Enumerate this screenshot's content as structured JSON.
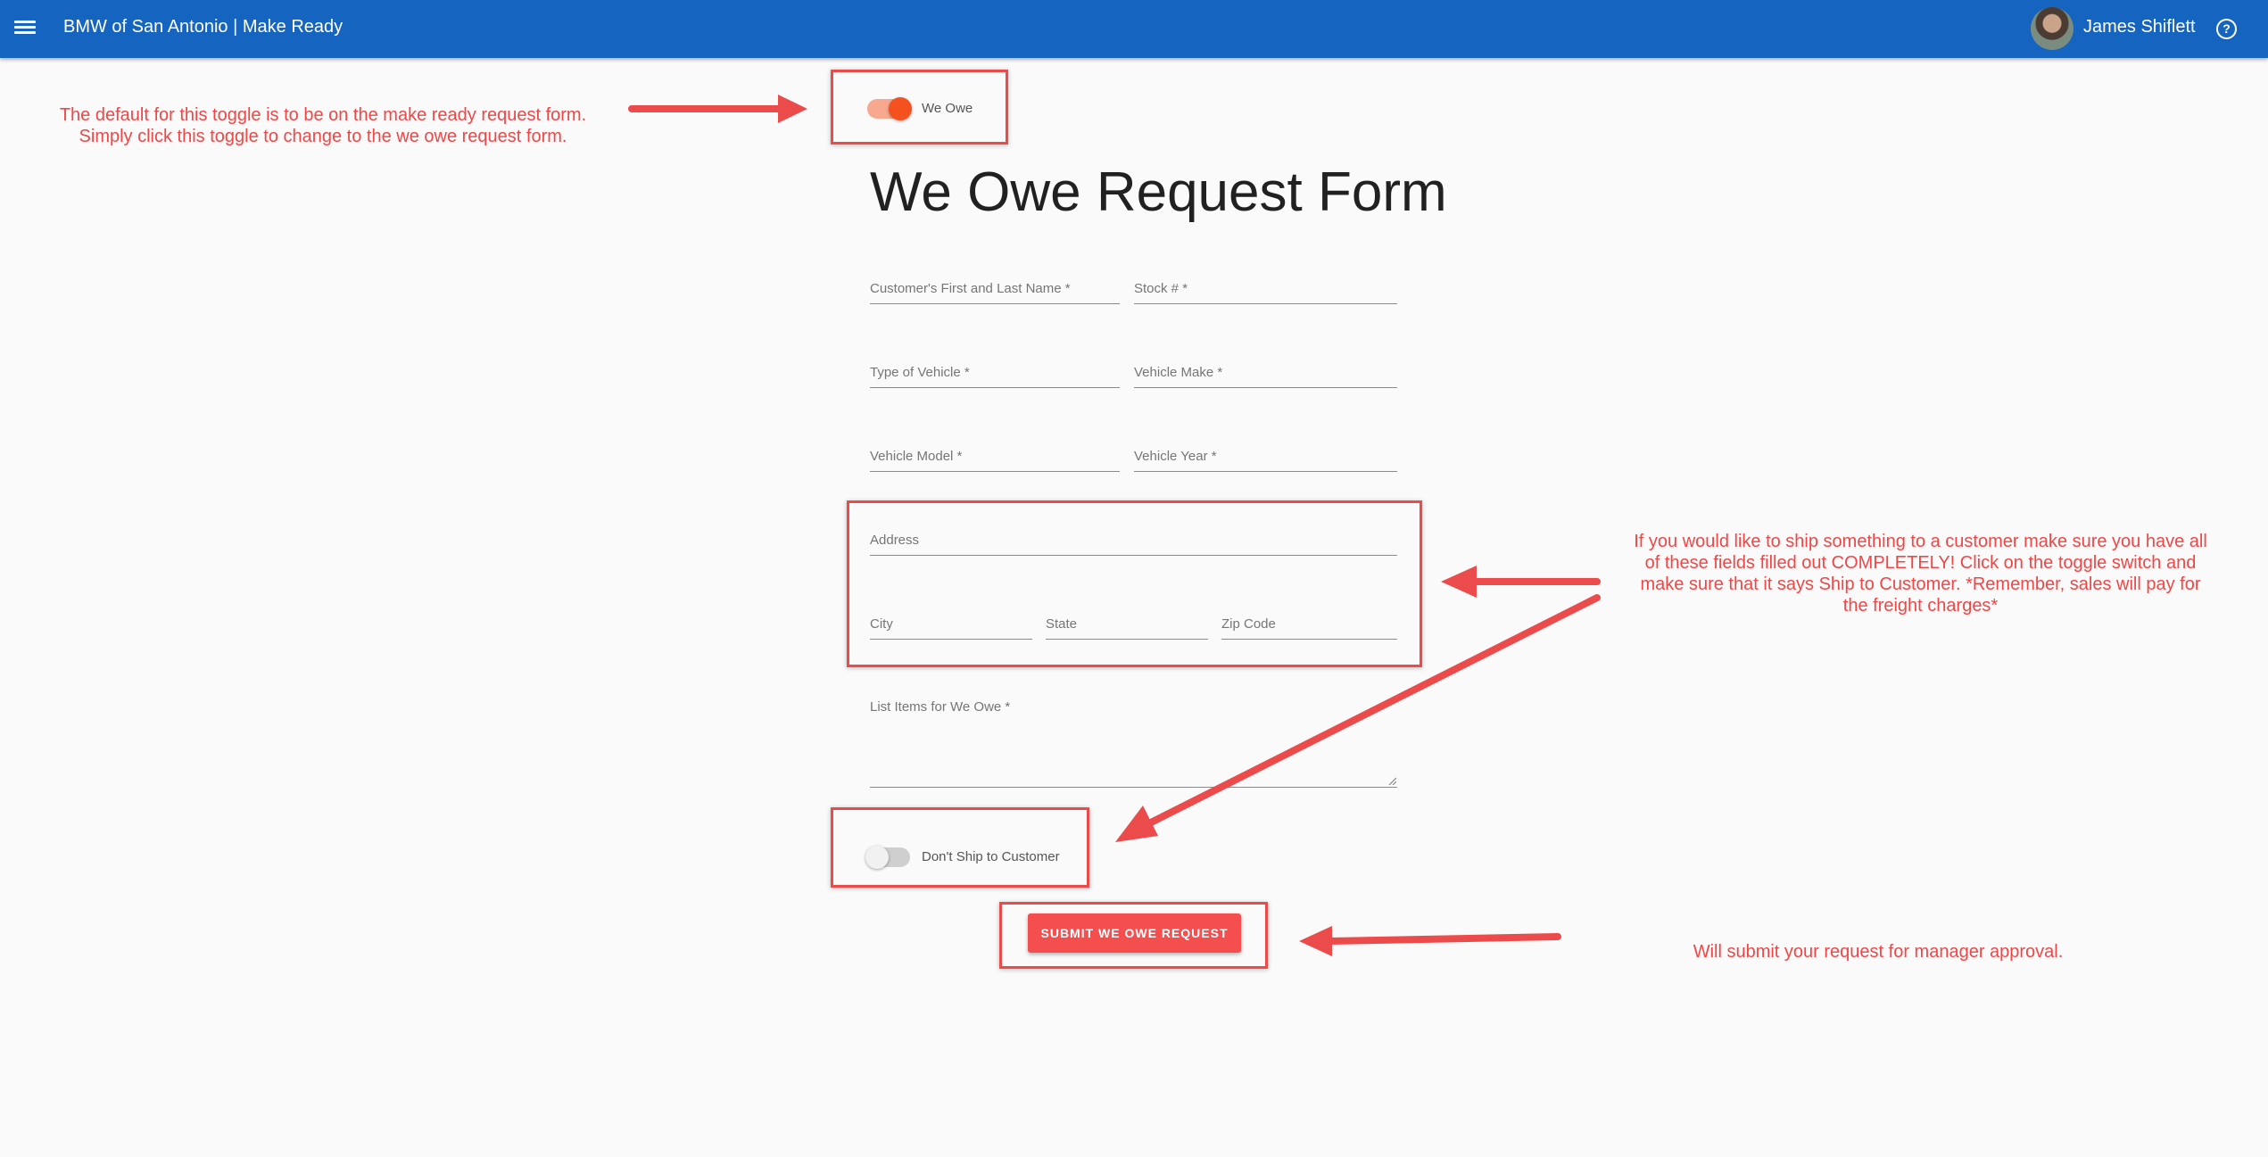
{
  "header": {
    "title": "BMW of San Antonio | Make Ready",
    "user_name": "James Shiflett"
  },
  "form": {
    "mode_toggle": {
      "label": "We Owe",
      "checked": true
    },
    "title": "We Owe Request Form",
    "fields": {
      "customer_name": "Customer's First and Last Name *",
      "stock_number": "Stock # *",
      "vehicle_type": "Type of Vehicle *",
      "vehicle_make": "Vehicle Make *",
      "vehicle_model": "Vehicle Model *",
      "vehicle_year": "Vehicle Year *",
      "address": "Address",
      "city": "City",
      "state": "State",
      "zip": "Zip Code",
      "list_items": "List Items for We Owe *"
    },
    "ship_toggle": {
      "label": "Don't Ship to Customer",
      "checked": false
    },
    "submit_label": "SUBMIT WE OWE REQUEST"
  },
  "annotations": {
    "toggle_note": "The default for this toggle is to be on the make ready request form. Simply click this toggle to change to the we owe request form.",
    "address_note": "If you would like to ship something to a customer make sure you have all of these fields filled out COMPLETELY! Click on the toggle switch and make sure that it says Ship to Customer. *Remember, sales will pay for the freight charges*",
    "submit_note": "Will submit your request for manager approval."
  },
  "colors": {
    "app_bar": "#1565c0",
    "toggle_on": "#f4511e",
    "submit_button": "#f44e4e",
    "annotation": "#f04646"
  },
  "icons": {
    "menu": "menu-icon",
    "help": "help-icon",
    "avatar": "avatar"
  }
}
